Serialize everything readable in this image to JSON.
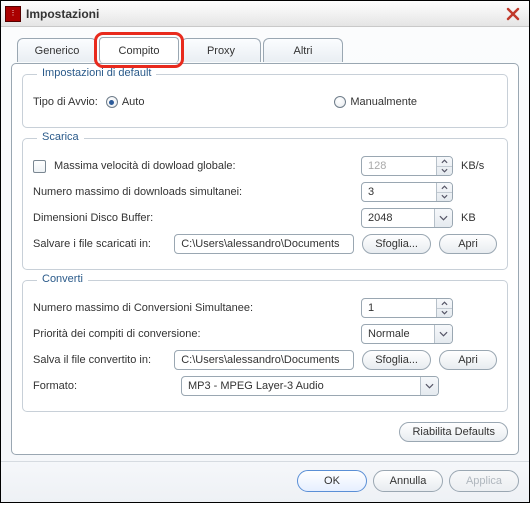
{
  "window": {
    "title": "Impostazioni"
  },
  "tabs": {
    "generic": "Generico",
    "task": "Compito",
    "proxy": "Proxy",
    "others": "Altri",
    "active": "task"
  },
  "defaults_group": {
    "legend": "Impostazioni di default",
    "startup_label": "Tipo di Avvio:",
    "auto": "Auto",
    "manual": "Manualmente"
  },
  "download_group": {
    "legend": "Scarica",
    "max_speed_label": "Massima velocità di dowload globale:",
    "max_speed_value": "128",
    "max_speed_unit": "KB/s",
    "max_simul_label": "Numero massimo di downloads simultanei:",
    "max_simul_value": "3",
    "buffer_label": "Dimensioni Disco Buffer:",
    "buffer_value": "2048",
    "buffer_unit": "KB",
    "save_label": "Salvare i file scaricati in:",
    "save_path": "C:\\Users\\alessandro\\Documents",
    "browse": "Sfoglia...",
    "open": "Apri"
  },
  "convert_group": {
    "legend": "Converti",
    "max_conv_label": "Numero massimo di Conversioni Simultanee:",
    "max_conv_value": "1",
    "priority_label": "Priorità dei compiti di conversione:",
    "priority_value": "Normale",
    "save_label": "Salva il file convertito in:",
    "save_path": "C:\\Users\\alessandro\\Documents",
    "browse": "Sfoglia...",
    "open": "Apri",
    "format_label": "Formato:",
    "format_value": "MP3 - MPEG Layer-3 Audio"
  },
  "restore_defaults": "Riabilita Defaults",
  "footer": {
    "ok": "OK",
    "cancel": "Annulla",
    "apply": "Applica"
  },
  "colors": {
    "highlight": "#e82a1d"
  }
}
